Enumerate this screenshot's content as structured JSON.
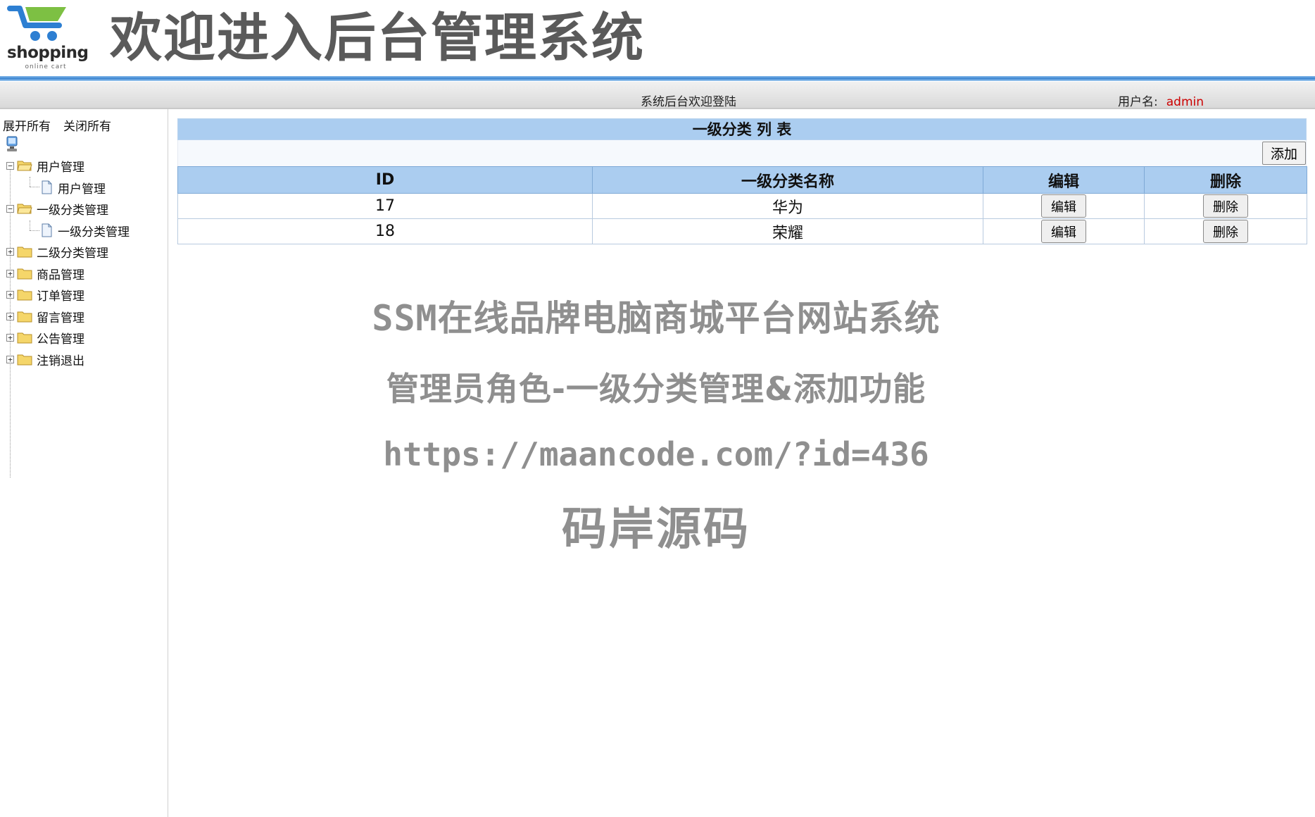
{
  "header": {
    "logo_text": "shopping",
    "logo_sub": "online cart",
    "title": "欢迎进入后台管理系统",
    "welcome": "系统后台欢迎登陆",
    "user_label": "用户名:",
    "username": "admin"
  },
  "sidebar": {
    "expand_all": "展开所有",
    "collapse_all": "关闭所有",
    "groups": [
      {
        "label": "用户管理",
        "expanded": true,
        "child": "用户管理"
      },
      {
        "label": "一级分类管理",
        "expanded": true,
        "child": "一级分类管理"
      },
      {
        "label": "二级分类管理",
        "expanded": false
      },
      {
        "label": "商品管理",
        "expanded": false
      },
      {
        "label": "订单管理",
        "expanded": false
      },
      {
        "label": "留言管理",
        "expanded": false
      },
      {
        "label": "公告管理",
        "expanded": false
      },
      {
        "label": "注销退出",
        "expanded": false
      }
    ]
  },
  "main": {
    "list_title": "一级分类 列 表",
    "add_label": "添加",
    "columns": [
      "ID",
      "一级分类名称",
      "编辑",
      "删除"
    ],
    "rows": [
      {
        "id": "17",
        "name": "华为",
        "edit": "编辑",
        "delete": "删除"
      },
      {
        "id": "18",
        "name": "荣耀",
        "edit": "编辑",
        "delete": "删除"
      }
    ]
  },
  "watermark": {
    "line1": "SSM在线品牌电脑商城平台网站系统",
    "line2": "管理员角色-一级分类管理&添加功能",
    "line3": "https://maancode.com/?id=436",
    "line4": "码岸源码"
  },
  "colors": {
    "accent_blue": "#3a84d0",
    "table_header": "#abcdf0",
    "username": "#cc0000",
    "logo_green": "#7dc043",
    "logo_blue": "#2d7fd2"
  }
}
